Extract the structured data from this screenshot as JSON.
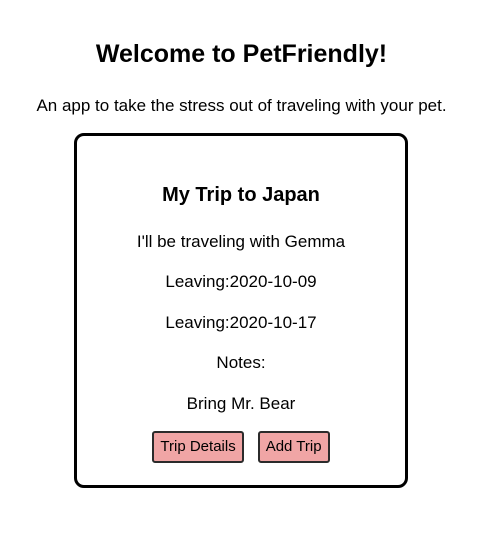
{
  "header": {
    "title": "Welcome to PetFriendly!",
    "subtitle": "An app to take the stress out of traveling with your pet."
  },
  "trip": {
    "title": "My Trip to Japan",
    "companion": "I'll be traveling with Gemma",
    "leaving_1": "Leaving:2020-10-09",
    "leaving_2": "Leaving:2020-10-17",
    "notes_label": "Notes:",
    "notes_value": "Bring Mr. Bear",
    "buttons": {
      "details_label": "Trip Details",
      "add_label": "Add Trip"
    }
  },
  "colors": {
    "button_background": "#f0a5a5",
    "card_border": "#000000"
  }
}
